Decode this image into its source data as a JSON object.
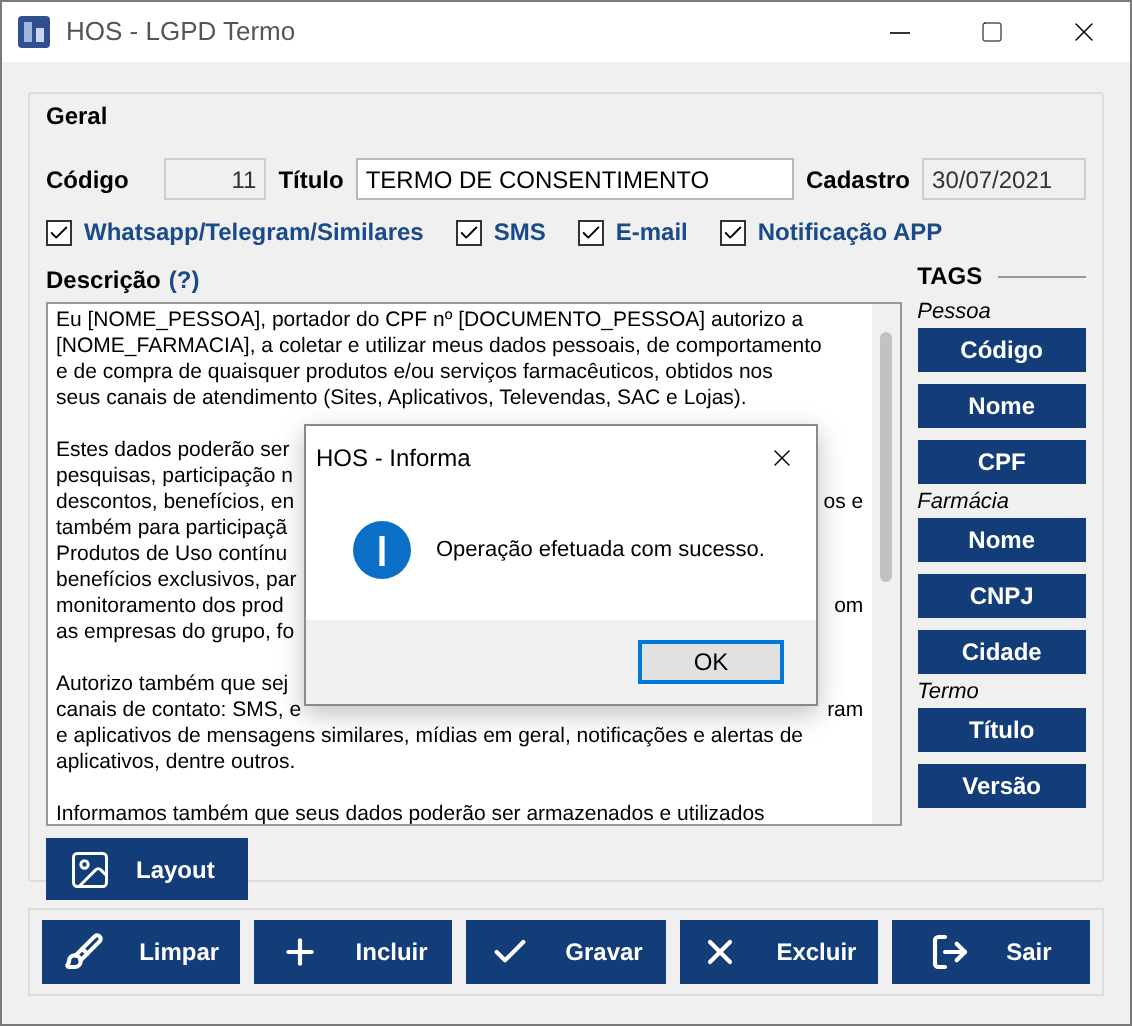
{
  "window": {
    "title": "HOS - LGPD Termo"
  },
  "group": {
    "title": "Geral"
  },
  "fields": [
    {
      "label": "Código",
      "value": "11",
      "disabled": true
    },
    {
      "label": "Título",
      "value": "TERMO DE CONSENTIMENTO",
      "disabled": false
    },
    {
      "label": "Cadastro",
      "value": "30/07/2021",
      "disabled": true
    }
  ],
  "channels": [
    {
      "label": "Whatsapp/Telegram/Similares",
      "checked": true
    },
    {
      "label": "SMS",
      "checked": true
    },
    {
      "label": "E-mail",
      "checked": true
    },
    {
      "label": "Notificação APP",
      "checked": true
    }
  ],
  "description": {
    "label": "Descrição",
    "help": "(?)",
    "paragraphs": [
      [
        {
          "left": "Eu [NOME_PESSOA], portador do CPF nº [DOCUMENTO_PESSOA] autorizo a"
        },
        {
          "left": "[NOME_FARMACIA], a coletar e utilizar meus dados pessoais, de comportamento"
        },
        {
          "left": "e de compra de quaisquer produtos e/ou serviços farmacêuticos, obtidos nos"
        },
        {
          "left": "seus canais de atendimento (Sites, Aplicativos, Televendas, SAC e Lojas)."
        }
      ],
      [
        {
          "left": "Estes dados poderão ser"
        },
        {
          "left": "pesquisas, participação n"
        },
        {
          "left": "descontos, benefícios, en",
          "right": "os e"
        },
        {
          "left": "também para participaçã"
        },
        {
          "left": "Produtos de Uso contínu"
        },
        {
          "left": "benefícios exclusivos, par"
        },
        {
          "left": "monitoramento dos prod",
          "right": "om"
        },
        {
          "left": "as empresas do grupo, fo"
        }
      ],
      [
        {
          "left": "Autorizo também que sej"
        },
        {
          "left": "canais de contato: SMS, e",
          "right": "ram"
        },
        {
          "left": "e aplicativos de mensagens similares, mídias em geral, notificações e alertas de"
        },
        {
          "left": "aplicativos, dentre outros."
        }
      ],
      [
        {
          "left": "Informamos também que seus dados poderão ser armazenados e utilizados"
        }
      ]
    ]
  },
  "tags": {
    "title": "TAGS",
    "groups": [
      {
        "label": "Pessoa",
        "items": [
          "Código",
          "Nome",
          "CPF"
        ]
      },
      {
        "label": "Farmácia",
        "items": [
          "Nome",
          "CNPJ",
          "Cidade"
        ]
      },
      {
        "label": "Termo",
        "items": [
          "Título",
          "Versão"
        ]
      }
    ]
  },
  "layout_button": "Layout",
  "actions": [
    "Limpar",
    "Incluir",
    "Gravar",
    "Excluir",
    "Sair"
  ],
  "dialog": {
    "title": "HOS - Informa",
    "message": "Operação efetuada com sucesso.",
    "button": "OK"
  }
}
